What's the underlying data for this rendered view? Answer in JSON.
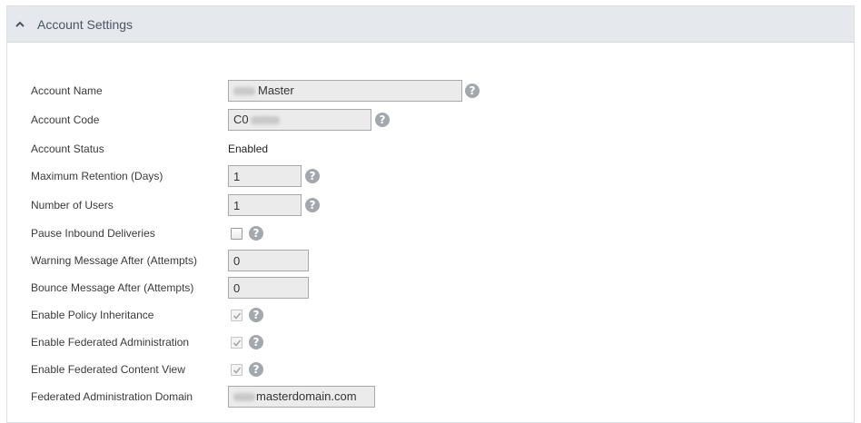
{
  "panel": {
    "title": "Account Settings"
  },
  "fields": {
    "account_name": {
      "label": "Account Name",
      "value": "Master"
    },
    "account_code": {
      "label": "Account Code",
      "value": "C0"
    },
    "account_status": {
      "label": "Account Status",
      "value": "Enabled"
    },
    "max_retention": {
      "label": "Maximum Retention (Days)",
      "value": "1"
    },
    "num_users": {
      "label": "Number of Users",
      "value": "1"
    },
    "pause_inbound": {
      "label": "Pause Inbound Deliveries",
      "checked": false
    },
    "warning_msg": {
      "label": "Warning Message After (Attempts)",
      "value": "0"
    },
    "bounce_msg": {
      "label": "Bounce Message After (Attempts)",
      "value": "0"
    },
    "policy_inheritance": {
      "label": "Enable Policy Inheritance",
      "checked": true
    },
    "federated_admin": {
      "label": "Enable Federated Administration",
      "checked": true
    },
    "federated_content": {
      "label": "Enable Federated Content View",
      "checked": true
    },
    "federated_domain": {
      "label": "Federated Administration Domain",
      "value": "masterdomain.com"
    }
  },
  "icons": {
    "collapse": "chevron-up-icon",
    "help": "question-mark-icon",
    "help_glyph": "?"
  },
  "colors": {
    "header_bg": "#e5e8ec",
    "field_bg": "#ebebeb",
    "help_bg": "#a3a8ae"
  }
}
